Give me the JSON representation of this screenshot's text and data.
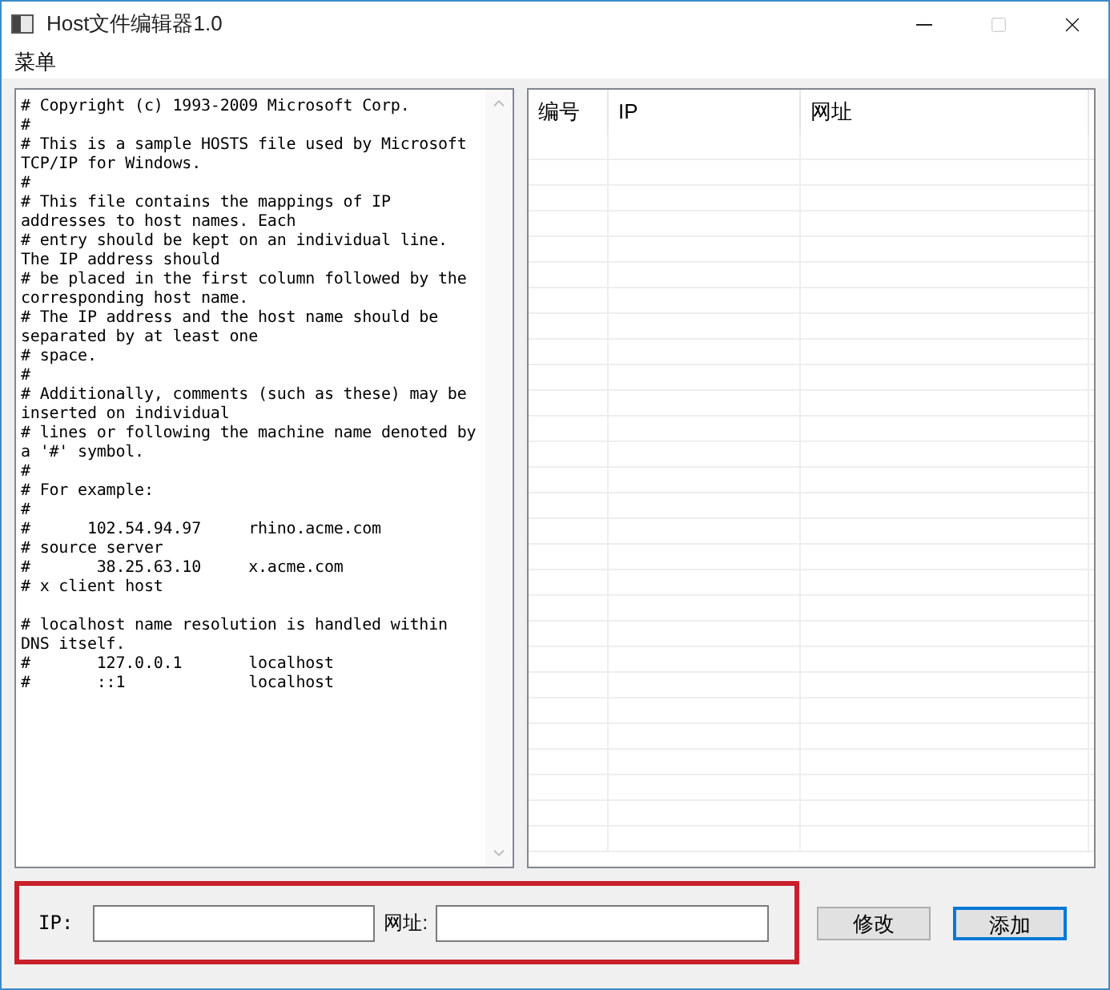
{
  "window": {
    "title": "Host文件编辑器1.0"
  },
  "menu": [
    "菜单"
  ],
  "editor": {
    "blocks": [
      [
        "# Copyright (c) 1993-2009 Microsoft Corp.",
        "#",
        "# This is a sample HOSTS file used by Microsoft",
        "TCP/IP for Windows.",
        "#",
        "# This file contains the mappings of IP",
        "addresses to host names. Each",
        "# entry should be kept on an individual line.",
        "The IP address should",
        "# be placed in the first column followed by the",
        "corresponding host name.",
        "# The IP address and the host name should be",
        "separated by at least one",
        "# space.",
        "#",
        "# Additionally, comments (such as these) may be",
        "inserted on individual",
        "# lines or following the machine name denoted by",
        "a '#' symbol.",
        "#",
        "# For example:",
        "#",
        "#      102.54.94.97     rhino.acme.com",
        "# source server",
        "#       38.25.63.10     x.acme.com",
        "# x client host"
      ],
      [
        "# localhost name resolution is handled within",
        "DNS itself.",
        "#       127.0.0.1       localhost",
        "#       ::1             localhost"
      ]
    ]
  },
  "table": {
    "columns": [
      "编号",
      "IP",
      "网址"
    ]
  },
  "form": {
    "fields": [
      {
        "label": "IP:"
      },
      {
        "label": "网址:"
      }
    ]
  },
  "buttons": [
    {
      "label": "修改",
      "default": false
    },
    {
      "label": "添加",
      "default": true
    }
  ]
}
